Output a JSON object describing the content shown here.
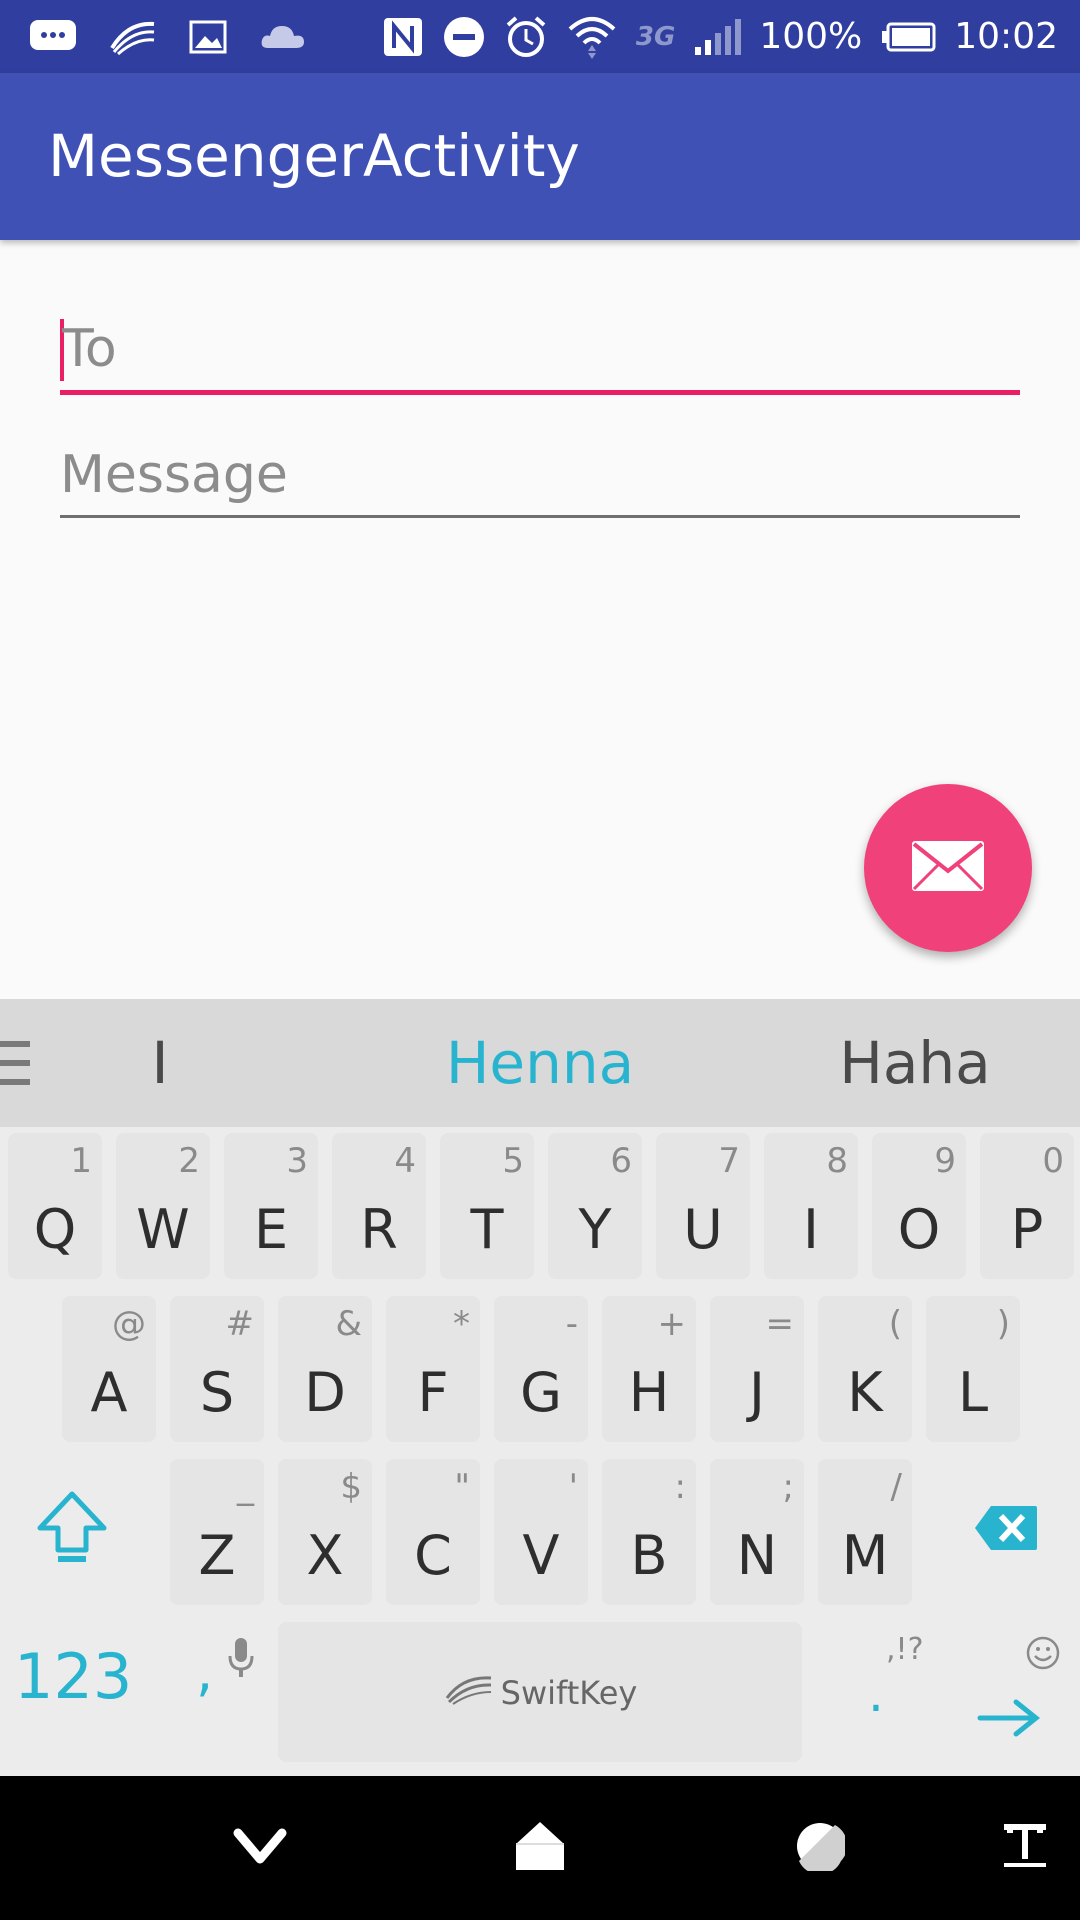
{
  "status_bar": {
    "battery": "100%",
    "time": "10:02",
    "network": "3G",
    "icons": [
      "chat-icon",
      "swiftkey-icon",
      "image-icon",
      "cloud-icon",
      "nfc-icon",
      "do-not-disturb-icon",
      "alarm-icon",
      "wifi-icon",
      "signal-icon",
      "battery-icon"
    ]
  },
  "app_bar": {
    "title": "MessengerActivity"
  },
  "form": {
    "to": {
      "placeholder": "To"
    },
    "message": {
      "placeholder": "Message"
    }
  },
  "fab": {
    "icon": "envelope-icon"
  },
  "keyboard": {
    "suggestions": [
      "I",
      "Henna",
      "Haha"
    ],
    "accent_color": "#28b4cf",
    "rows": [
      [
        [
          "Q",
          "1"
        ],
        [
          "W",
          "2"
        ],
        [
          "E",
          "3"
        ],
        [
          "R",
          "4"
        ],
        [
          "T",
          "5"
        ],
        [
          "Y",
          "6"
        ],
        [
          "U",
          "7"
        ],
        [
          "I",
          "8"
        ],
        [
          "O",
          "9"
        ],
        [
          "P",
          "0"
        ]
      ],
      [
        [
          "A",
          "@"
        ],
        [
          "S",
          "#"
        ],
        [
          "D",
          "&"
        ],
        [
          "F",
          "*"
        ],
        [
          "G",
          "-"
        ],
        [
          "H",
          "+"
        ],
        [
          "J",
          "="
        ],
        [
          "K",
          "("
        ],
        [
          "L",
          ")"
        ]
      ],
      [
        [
          "Z",
          "_"
        ],
        [
          "X",
          "$"
        ],
        [
          "C",
          "\""
        ],
        [
          "V",
          "'"
        ],
        [
          "B",
          ":"
        ],
        [
          "N",
          ";"
        ],
        [
          "M",
          "/"
        ]
      ]
    ],
    "numbers_label": "123",
    "comma": ",",
    "period": ".",
    "punctuation_hint": ",!?",
    "space_brand": "SwiftKey"
  },
  "navbar": {
    "icons": [
      "back-icon",
      "home-icon",
      "recents-icon",
      "keyboard-switch-icon"
    ]
  },
  "colors": {
    "primary": "#3f51b5",
    "primary_dark": "#303f9f",
    "accent": "#e91e63"
  }
}
